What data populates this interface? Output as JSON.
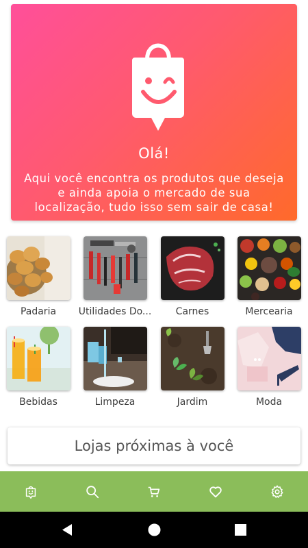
{
  "hero": {
    "title": "Olá!",
    "text": "Aqui você encontra os produtos que deseja e ainda apoia o mercado de sua localização, tudo isso sem sair de casa!",
    "logo_icon": "smiling-shopping-bag-icon",
    "gradient_start": "#ff4f9a",
    "gradient_end": "#ff6a2a"
  },
  "categories": [
    {
      "label": "Padaria",
      "image": "bread-basket"
    },
    {
      "label": "Utilidades Do...",
      "image": "hand-tools"
    },
    {
      "label": "Carnes",
      "image": "raw-steak"
    },
    {
      "label": "Mercearia",
      "image": "spices-and-vegetables"
    },
    {
      "label": "Bebidas",
      "image": "orange-drinks"
    },
    {
      "label": "Limpeza",
      "image": "cleaning-mop"
    },
    {
      "label": "Jardim",
      "image": "garden-seedlings"
    },
    {
      "label": "Moda",
      "image": "clothes-and-shoes"
    }
  ],
  "nearby_button": {
    "label": "Lojas próximas à você"
  },
  "bottom_nav": {
    "background": "#8bbd5a",
    "items": [
      {
        "icon": "home-bag-icon"
      },
      {
        "icon": "search-icon"
      },
      {
        "icon": "cart-icon"
      },
      {
        "icon": "heart-icon"
      },
      {
        "icon": "gear-icon"
      }
    ]
  },
  "system_nav": {
    "items": [
      {
        "icon": "back-icon"
      },
      {
        "icon": "home-icon"
      },
      {
        "icon": "recents-icon"
      }
    ]
  }
}
